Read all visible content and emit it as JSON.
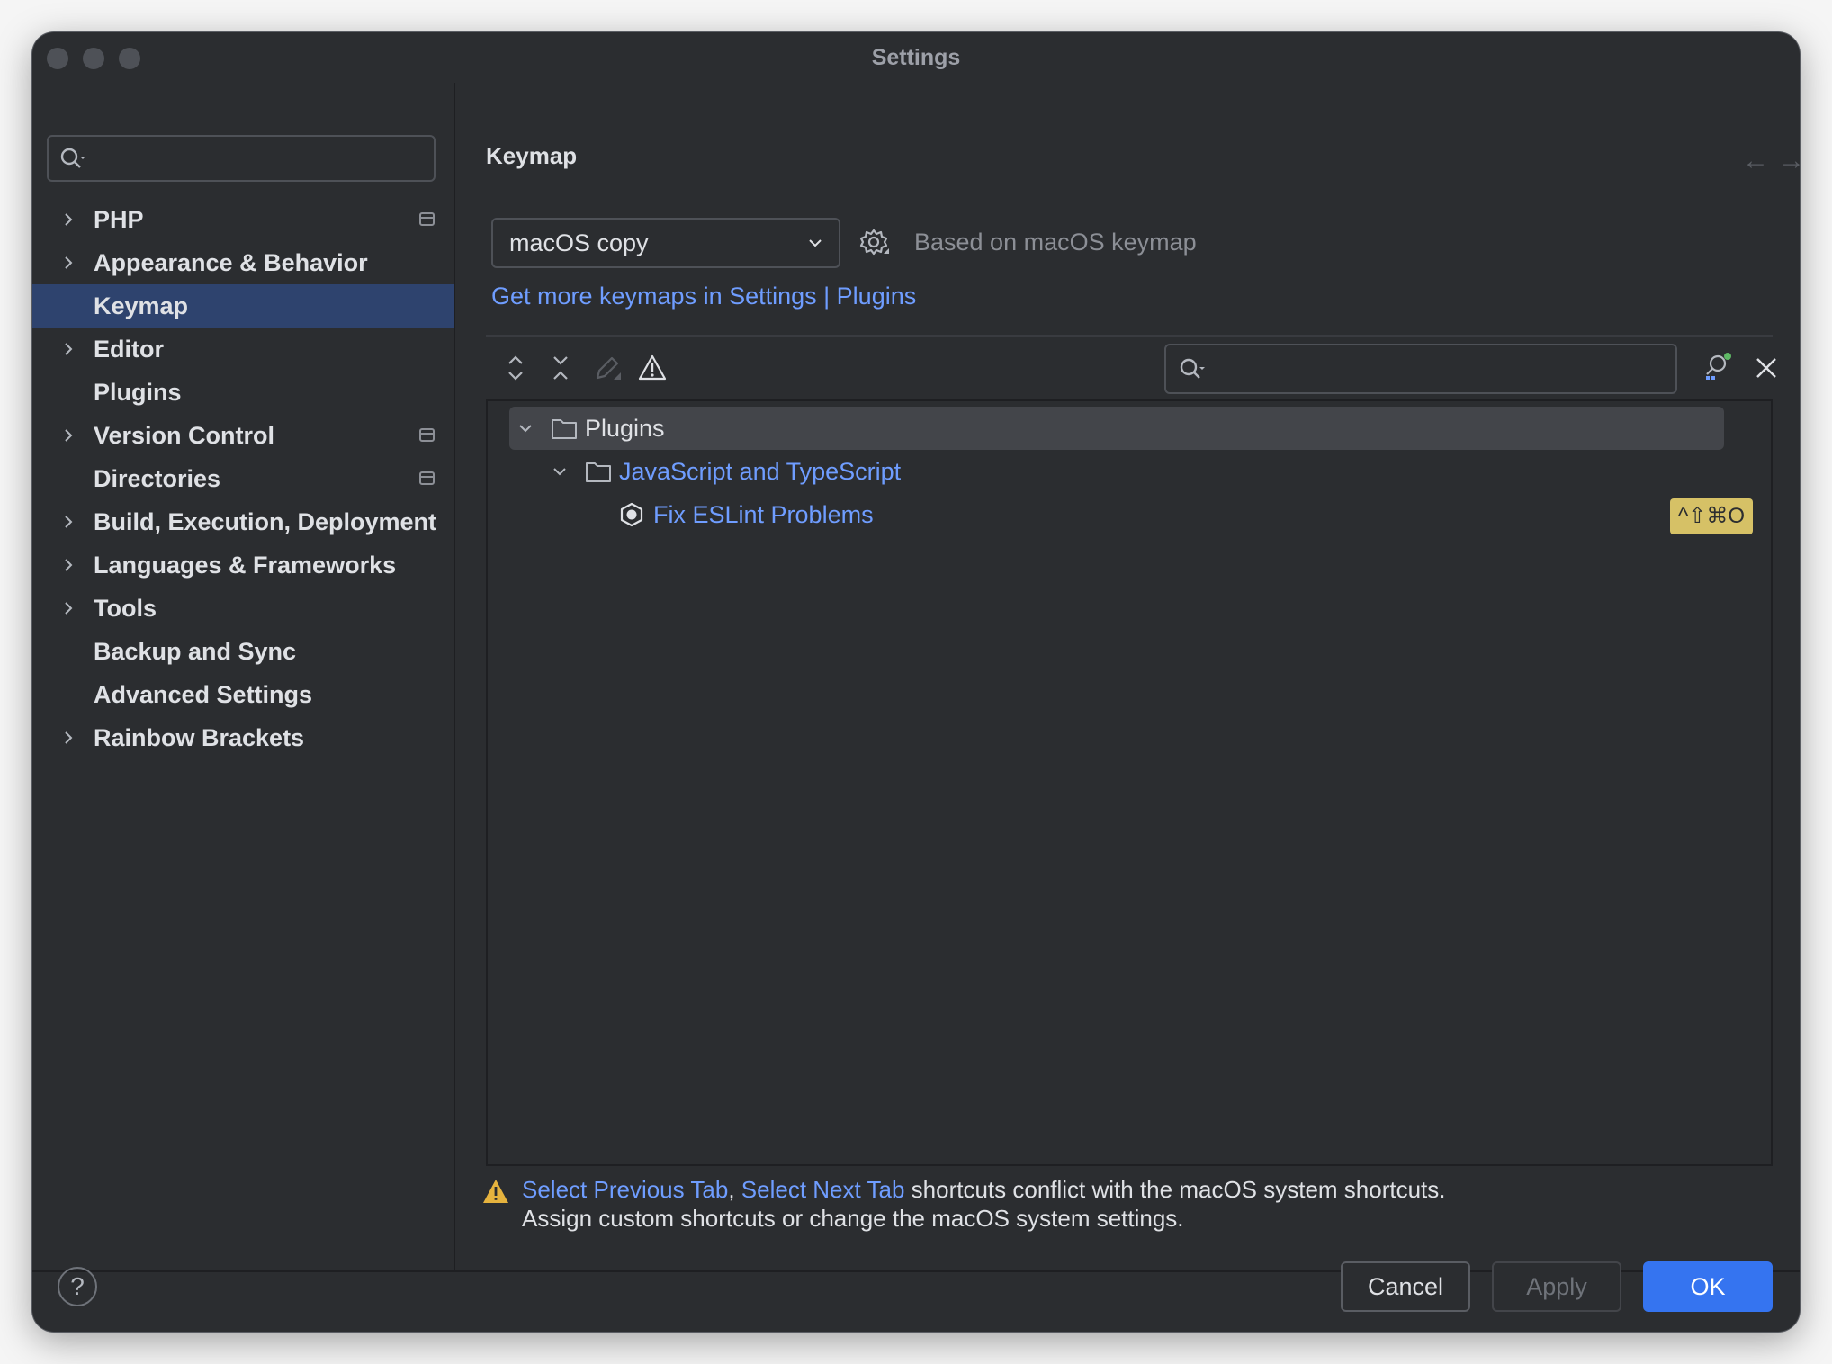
{
  "window": {
    "title": "Settings"
  },
  "sidebar": {
    "search_placeholder": "",
    "items": [
      {
        "label": "PHP",
        "expandable": true,
        "project_icon": true
      },
      {
        "label": "Appearance & Behavior",
        "expandable": true,
        "project_icon": false
      },
      {
        "label": "Keymap",
        "expandable": false,
        "project_icon": false,
        "selected": true
      },
      {
        "label": "Editor",
        "expandable": true,
        "project_icon": false
      },
      {
        "label": "Plugins",
        "expandable": false,
        "project_icon": false
      },
      {
        "label": "Version Control",
        "expandable": true,
        "project_icon": true
      },
      {
        "label": "Directories",
        "expandable": false,
        "project_icon": true
      },
      {
        "label": "Build, Execution, Deployment",
        "expandable": true,
        "project_icon": false
      },
      {
        "label": "Languages & Frameworks",
        "expandable": true,
        "project_icon": false
      },
      {
        "label": "Tools",
        "expandable": true,
        "project_icon": false
      },
      {
        "label": "Backup and Sync",
        "expandable": false,
        "project_icon": false
      },
      {
        "label": "Advanced Settings",
        "expandable": false,
        "project_icon": false
      },
      {
        "label": "Rainbow Brackets",
        "expandable": true,
        "project_icon": false
      }
    ]
  },
  "content": {
    "title": "Keymap",
    "keymap_select": {
      "value": "macOS copy"
    },
    "based_on": "Based on macOS keymap",
    "more_keymaps_link": "Get more keymaps in Settings | Plugins",
    "search_placeholder": "",
    "tree": {
      "root": "Plugins",
      "child": "JavaScript and TypeScript",
      "action": "Fix ESLint Problems",
      "shortcut": "^⇧⌘O"
    },
    "warning": {
      "link1": "Select Previous Tab",
      "sep": ",",
      "link2": "Select Next Tab",
      "text1": " shortcuts conflict with the macOS system shortcuts.",
      "text2": "Assign custom shortcuts or change the macOS system settings."
    }
  },
  "footer": {
    "help": "?",
    "cancel": "Cancel",
    "apply": "Apply",
    "ok": "OK"
  },
  "colors": {
    "background": "#2b2d30",
    "selection": "#2e436e",
    "link": "#6f9dff",
    "primary_button": "#3574f0",
    "shortcut_badge": "#d6c166"
  }
}
